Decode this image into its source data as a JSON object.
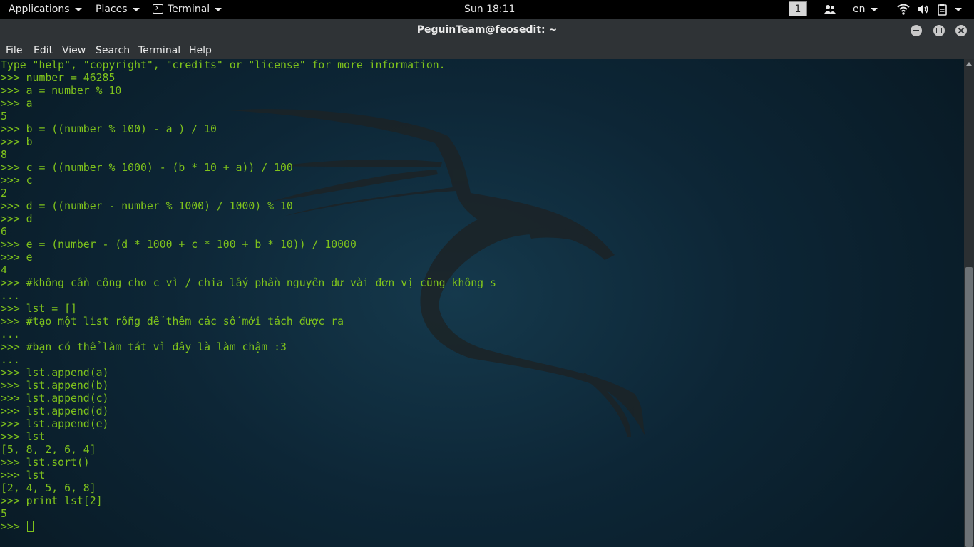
{
  "topbar": {
    "applications": "Applications",
    "places": "Places",
    "terminal": "Terminal",
    "clock": "Sun 18:11",
    "workspace": "1",
    "language": "en",
    "icons": [
      "people-icon",
      "wifi-icon",
      "volume-icon",
      "clipboard-icon"
    ]
  },
  "window": {
    "title": "PeguinTeam@feosedit: ~"
  },
  "menu": {
    "file": "File",
    "edit": "Edit",
    "view": "View",
    "search": "Search",
    "terminal": "Terminal",
    "help": "Help"
  },
  "terminal": {
    "text_color": "#7fc31c",
    "lines": [
      "Type \"help\", \"copyright\", \"credits\" or \"license\" for more information.",
      ">>> number = 46285",
      ">>> a = number % 10",
      ">>> a",
      "5",
      ">>> b = ((number % 100) - a ) / 10",
      ">>> b",
      "8",
      ">>> c = ((number % 1000) - (b * 10 + a)) / 100",
      ">>> c",
      "2",
      ">>> d = ((number - number % 1000) / 1000) % 10",
      ">>> d",
      "6",
      ">>> e = (number - (d * 1000 + c * 100 + b * 10)) / 10000",
      ">>> e",
      "4",
      ">>> #không cần cộng cho c vì / chia lấy phần nguyên dư vài đơn vị cũng không s",
      "...",
      ">>> lst = []",
      ">>> #tạo một list rỗng để thêm các số mới tách được ra",
      "...",
      ">>> #bạn có thể làm tát vì đây là làm chậm :3",
      "...",
      ">>> lst.append(a)",
      ">>> lst.append(b)",
      ">>> lst.append(c)",
      ">>> lst.append(d)",
      ">>> lst.append(e)",
      ">>> lst",
      "[5, 8, 2, 6, 4]",
      ">>> lst.sort()",
      ">>> lst",
      "[2, 4, 5, 6, 8]",
      ">>> print lst[2]",
      "5"
    ],
    "prompt": ">>> "
  }
}
